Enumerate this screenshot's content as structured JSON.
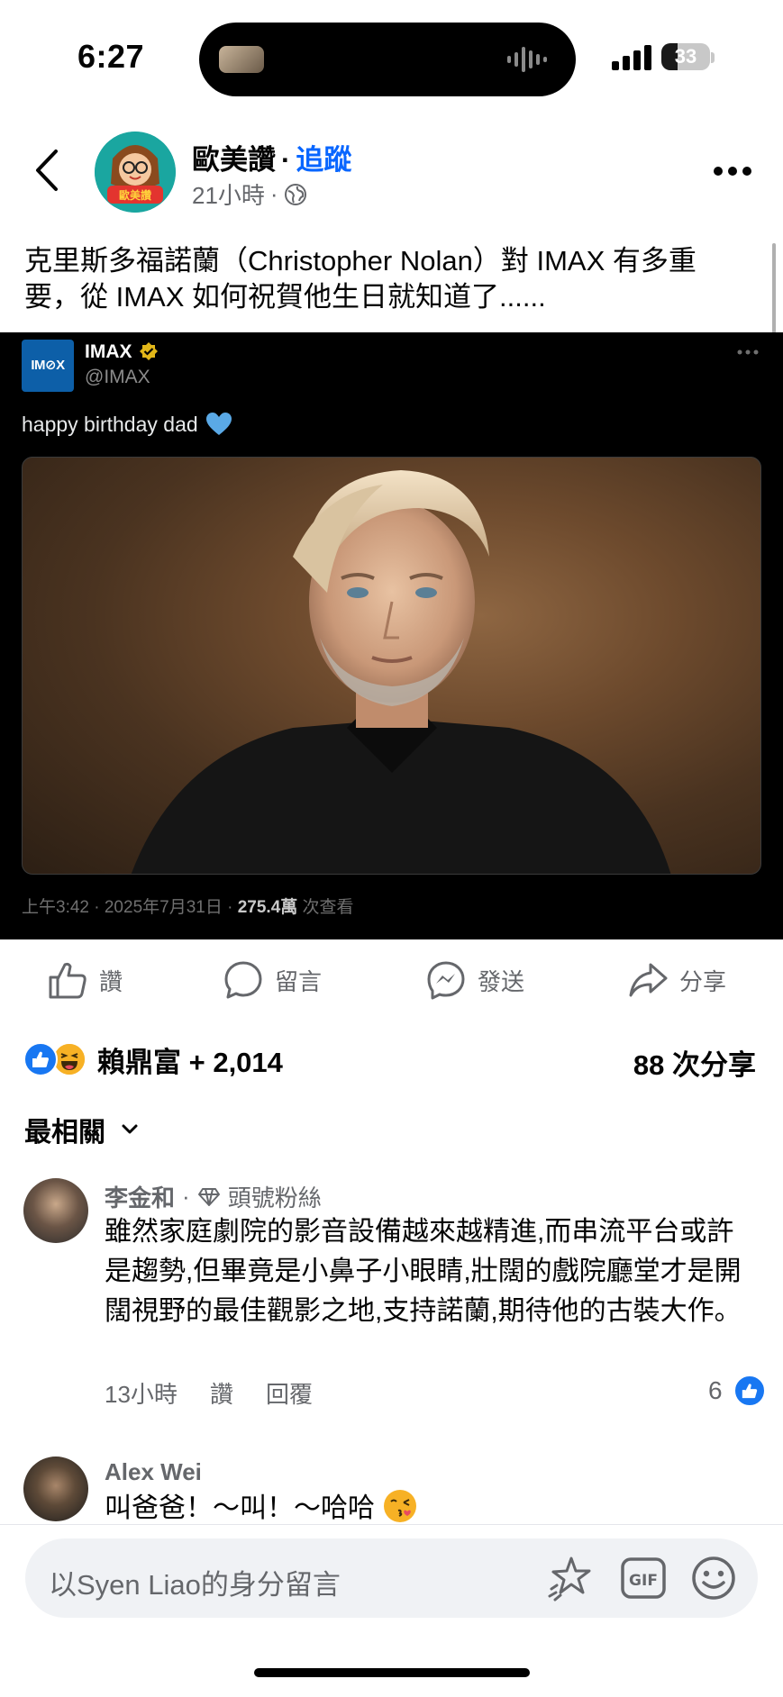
{
  "status_bar": {
    "time": "6:27",
    "battery": "33",
    "battery_fraction": 0.33
  },
  "post": {
    "page_name": "歐美讚",
    "separator": "·",
    "follow_label": "追蹤",
    "time_ago": "21小時",
    "meta_separator": "·",
    "caption": "克里斯多福諾蘭（Christopher Nolan）對 IMAX 有多重要，從 IMAX 如何祝賀他生日就知道了......",
    "tweet": {
      "logo_text": "IM⊘X",
      "name": "IMAX",
      "handle": "@IMAX",
      "text": "happy birthday dad",
      "meta_prefix": "上午3:42 · 2025年7月31日 · ",
      "views": "275.4萬",
      "views_suffix": " 次查看"
    },
    "actions": {
      "like": "讚",
      "comment": "留言",
      "send": "發送",
      "share": "分享"
    },
    "reactions_text": "賴鼎富 + 2,014",
    "shares_text": "88 次分享"
  },
  "comments_sort": "最相關",
  "comments": [
    {
      "author": "李金和",
      "separator": "·",
      "badge": "頭號粉絲",
      "text": "雖然家庭劇院的影音設備越來越精進,而串流平台或許是趨勢,但畢竟是小鼻子小眼睛,壯闊的戲院廳堂才是開闊視野的最佳觀影之地,支持諾蘭,期待他的古裝大作。",
      "time": "13小時",
      "like_label": "讚",
      "reply_label": "回覆",
      "like_count": "6"
    },
    {
      "author": "Alex Wei",
      "text": "叫爸爸！～叫！～哈哈"
    }
  ],
  "composer": {
    "placeholder": "以Syen  Liao的身分留言"
  },
  "colors": {
    "accent": "#0866ff",
    "like_blue": "#1877f2",
    "secondary_text": "#65676b"
  },
  "icons": [
    "back-arrow-icon",
    "globe-icon",
    "more-icon",
    "verified-icon",
    "heart-icon",
    "like-icon",
    "comment-icon",
    "messenger-icon",
    "share-icon",
    "haha-icon",
    "chevron-down-icon",
    "diamond-icon",
    "kiss-emoji-icon",
    "avatar-sticker-icon",
    "gif-icon",
    "emoji-icon"
  ]
}
